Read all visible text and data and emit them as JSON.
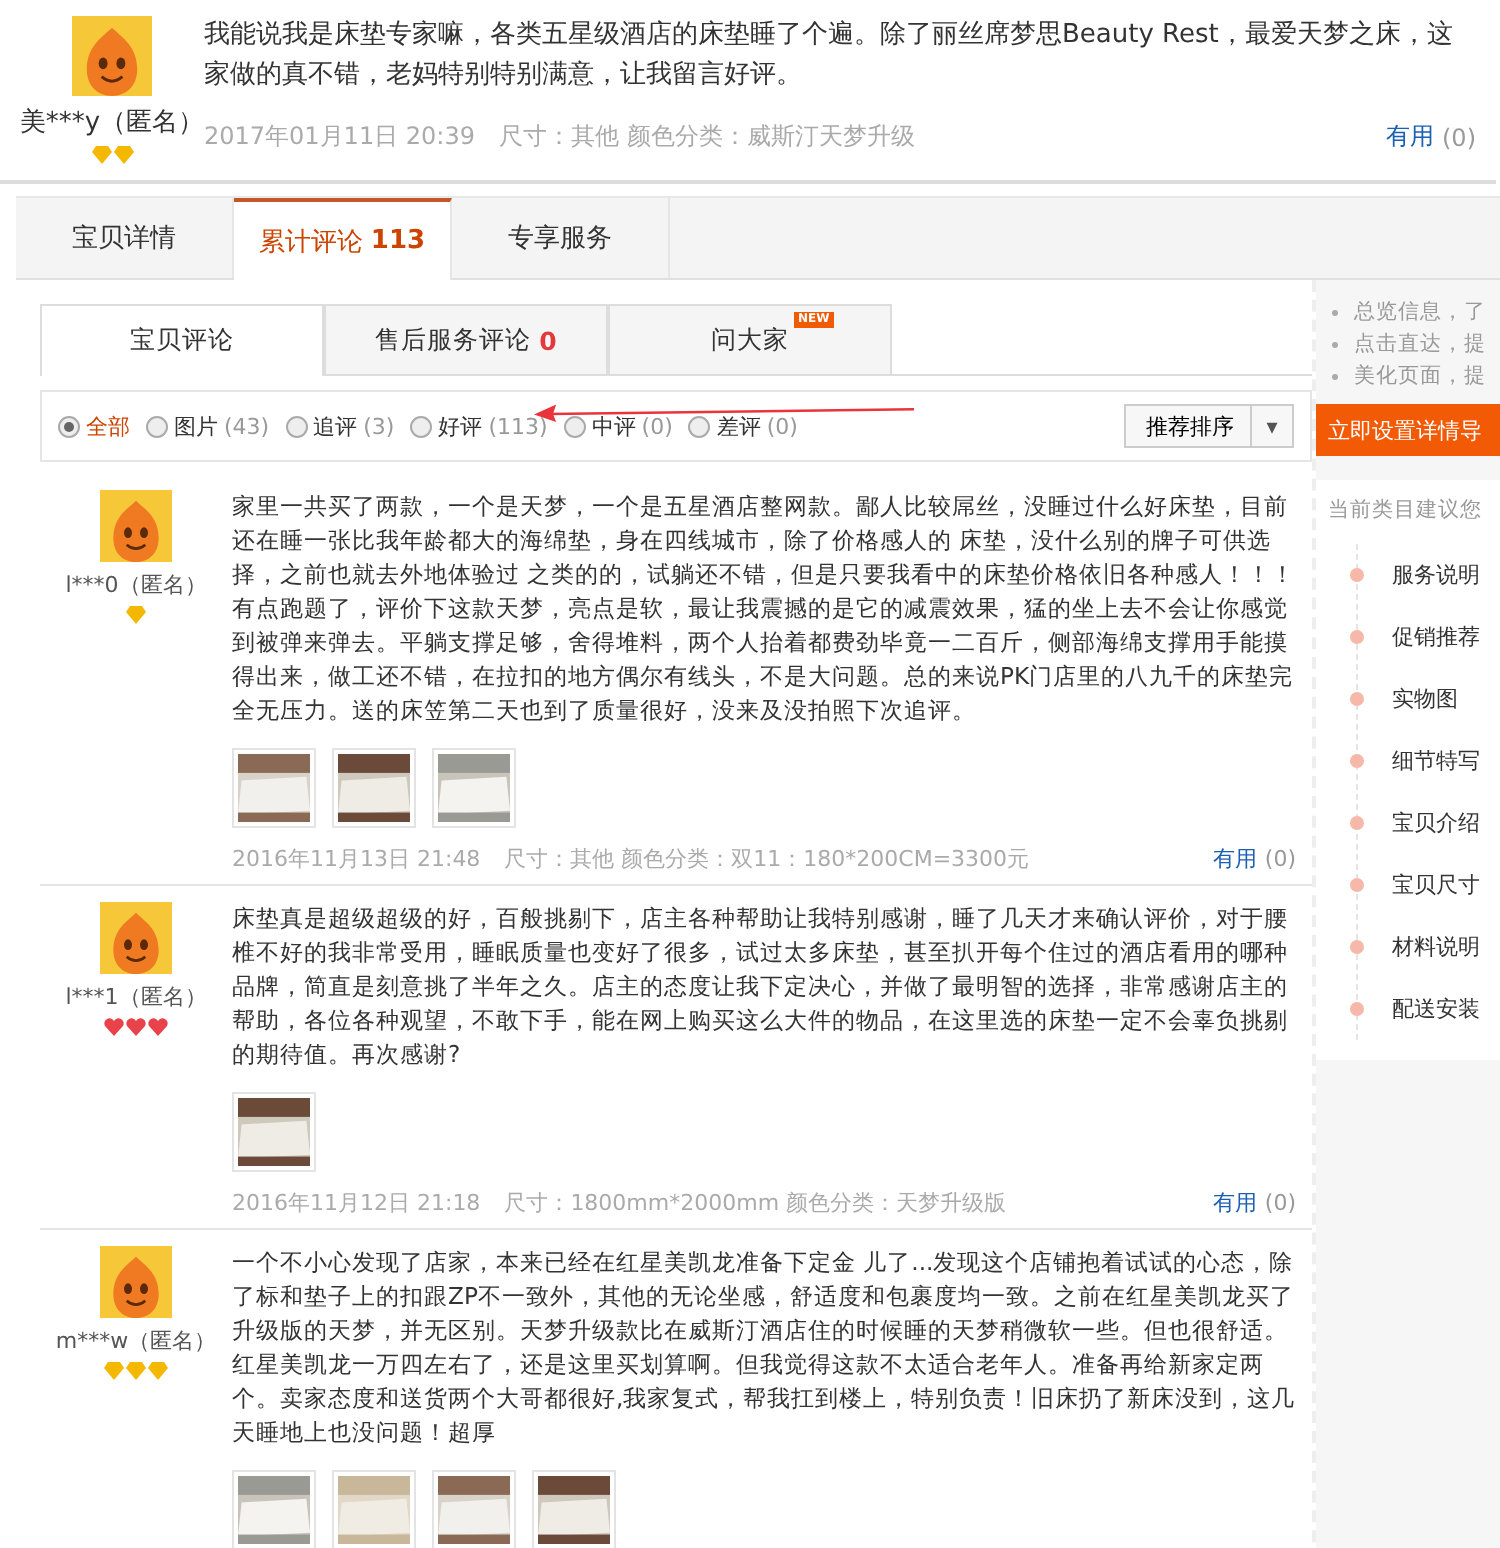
{
  "top_review": {
    "user": "美***y（匿名）",
    "badges": [
      {
        "kind": "diamond"
      },
      {
        "kind": "diamond"
      }
    ],
    "text": "我能说我是床垫专家嘛，各类五星级酒店的床垫睡了个遍。除了丽丝席梦思Beauty Rest，最爱天梦之床，这家做的真不错，老妈特别特别满意，让我留言好评。",
    "date": "2017年01月11日 20:39",
    "specs": "尺寸：其他  颜色分类：威斯汀天梦升级",
    "useful": "有用",
    "useful_count": "(0)"
  },
  "tabs": [
    {
      "label": "宝贝详情",
      "selected": false
    },
    {
      "label": "累计评论",
      "count": "113",
      "selected": true
    },
    {
      "label": "专享服务",
      "selected": false
    }
  ],
  "subtabs": [
    {
      "label": "宝贝评论",
      "new": false,
      "selected": true
    },
    {
      "label": "售后服务评论",
      "count": "0",
      "new": false,
      "selected": false
    },
    {
      "label": "问大家",
      "new": true,
      "selected": false
    }
  ],
  "new_badge": "NEW",
  "filters": [
    {
      "label": "全部",
      "selected": true
    },
    {
      "label": "图片",
      "count": "(43)",
      "selected": false
    },
    {
      "label": "追评",
      "count": "(3)",
      "selected": false
    },
    {
      "label": "好评",
      "count": "(113)",
      "selected": false
    },
    {
      "label": "中评",
      "count": "(0)",
      "selected": false
    },
    {
      "label": "差评",
      "count": "(0)",
      "selected": false
    }
  ],
  "sort": {
    "label": "推荐排序",
    "caret": "▾"
  },
  "reviews": [
    {
      "user": "l***0（匿名）",
      "badges": [
        {
          "kind": "diamond"
        }
      ],
      "text": "家里一共买了两款，一个是天梦，一个是五星酒店整网款。鄙人比较屌丝，没睡过什么好床垫，目前还在睡一张比我年龄都大的海绵垫，身在四线城市，除了价格感人的        床垫，没什么别的牌子可供选择，之前也就去外地体验过        之类的的，试躺还不错，但是只要我看中的床垫价格依旧各种感人！！！有点跑题了，评价下这款天梦，亮点是软，最让我震撼的是它的减震效果，猛的坐上去不会让你感觉到被弹来弹去。平躺支撑足够，舍得堆料，两个人抬着都费劲毕竟一二百斤，侧部海绵支撑用手能摸得出来，做工还不错，在拉扣的地方偶尔有线头，不是大问题。总的来说PK门店里的八九千的床垫完全无压力。送的床笠第二天也到了质量很好，没来及没拍照下次追评。",
      "photos": [
        {
          "kind": "picture"
        },
        {
          "kind": "picture"
        },
        {
          "kind": "picture"
        }
      ],
      "date": "2016年11月13日 21:48",
      "specs": "尺寸：其他  颜色分类：双11：180*200CM=3300元",
      "useful": "有用",
      "useful_count": "(0)"
    },
    {
      "user": "l***1（匿名）",
      "badges": [
        {
          "kind": "heart"
        },
        {
          "kind": "heart"
        },
        {
          "kind": "heart"
        }
      ],
      "text": "床垫真是超级超级的好，百般挑剔下，店主各种帮助让我特别感谢，睡了几天才来确认评价，对于腰椎不好的我非常受用，睡眠质量也变好了很多，试过太多床垫，甚至扒开每个住过的酒店看用的哪种品牌，简直是刻意挑了半年之久。店主的态度让我下定决心，并做了最明智的选择，非常感谢店主的帮助，各位各种观望，不敢下手，能在网上购买这么大件的物品，在这里选的床垫一定不会辜负挑剔的期待值。再次感谢?",
      "photos": [
        {
          "kind": "picture"
        }
      ],
      "date": "2016年11月12日 21:18",
      "specs": "尺寸：1800mm*2000mm  颜色分类：天梦升级版",
      "useful": "有用",
      "useful_count": "(0)"
    },
    {
      "user": "m***w（匿名）",
      "badges": [
        {
          "kind": "diamond"
        },
        {
          "kind": "diamond"
        },
        {
          "kind": "diamond"
        }
      ],
      "text": "一个不小心发现了店家，本来已经在红星美凯龙准备下定金   儿了...发现这个店铺抱着试试的心态，除了标和垫子上的扣跟ZP不一致外，其他的无论坐感，舒适度和包裹度均一致。之前在红星美凯龙买了升级版的天梦，并无区别。天梦升级款比在威斯汀酒店住的时候睡的天梦稍微软一些。但也很舒适。红星美凯龙一万四左右了，还是这里买划算啊。但我觉得这款不太适合老年人。准备再给新家定两个。卖家态度和送货两个大哥都很好,我家复式，帮我扛到楼上，特别负责！旧床扔了新床没到，这几天睡地上也没问题！超厚",
      "photos": [
        {
          "kind": "picture"
        },
        {
          "kind": "picture"
        },
        {
          "kind": "picture"
        },
        {
          "kind": "picture"
        }
      ]
    }
  ],
  "sidebar": {
    "tips": [
      "总览信息，了",
      "点击直达，提",
      "美化页面，提"
    ],
    "button": "立即设置详情导",
    "hint": "当前类目建议您",
    "items": [
      "服务说明",
      "促销推荐",
      "实物图",
      "细节特写",
      "宝贝介绍",
      "宝贝尺寸",
      "材料说明",
      "配送安装"
    ]
  }
}
